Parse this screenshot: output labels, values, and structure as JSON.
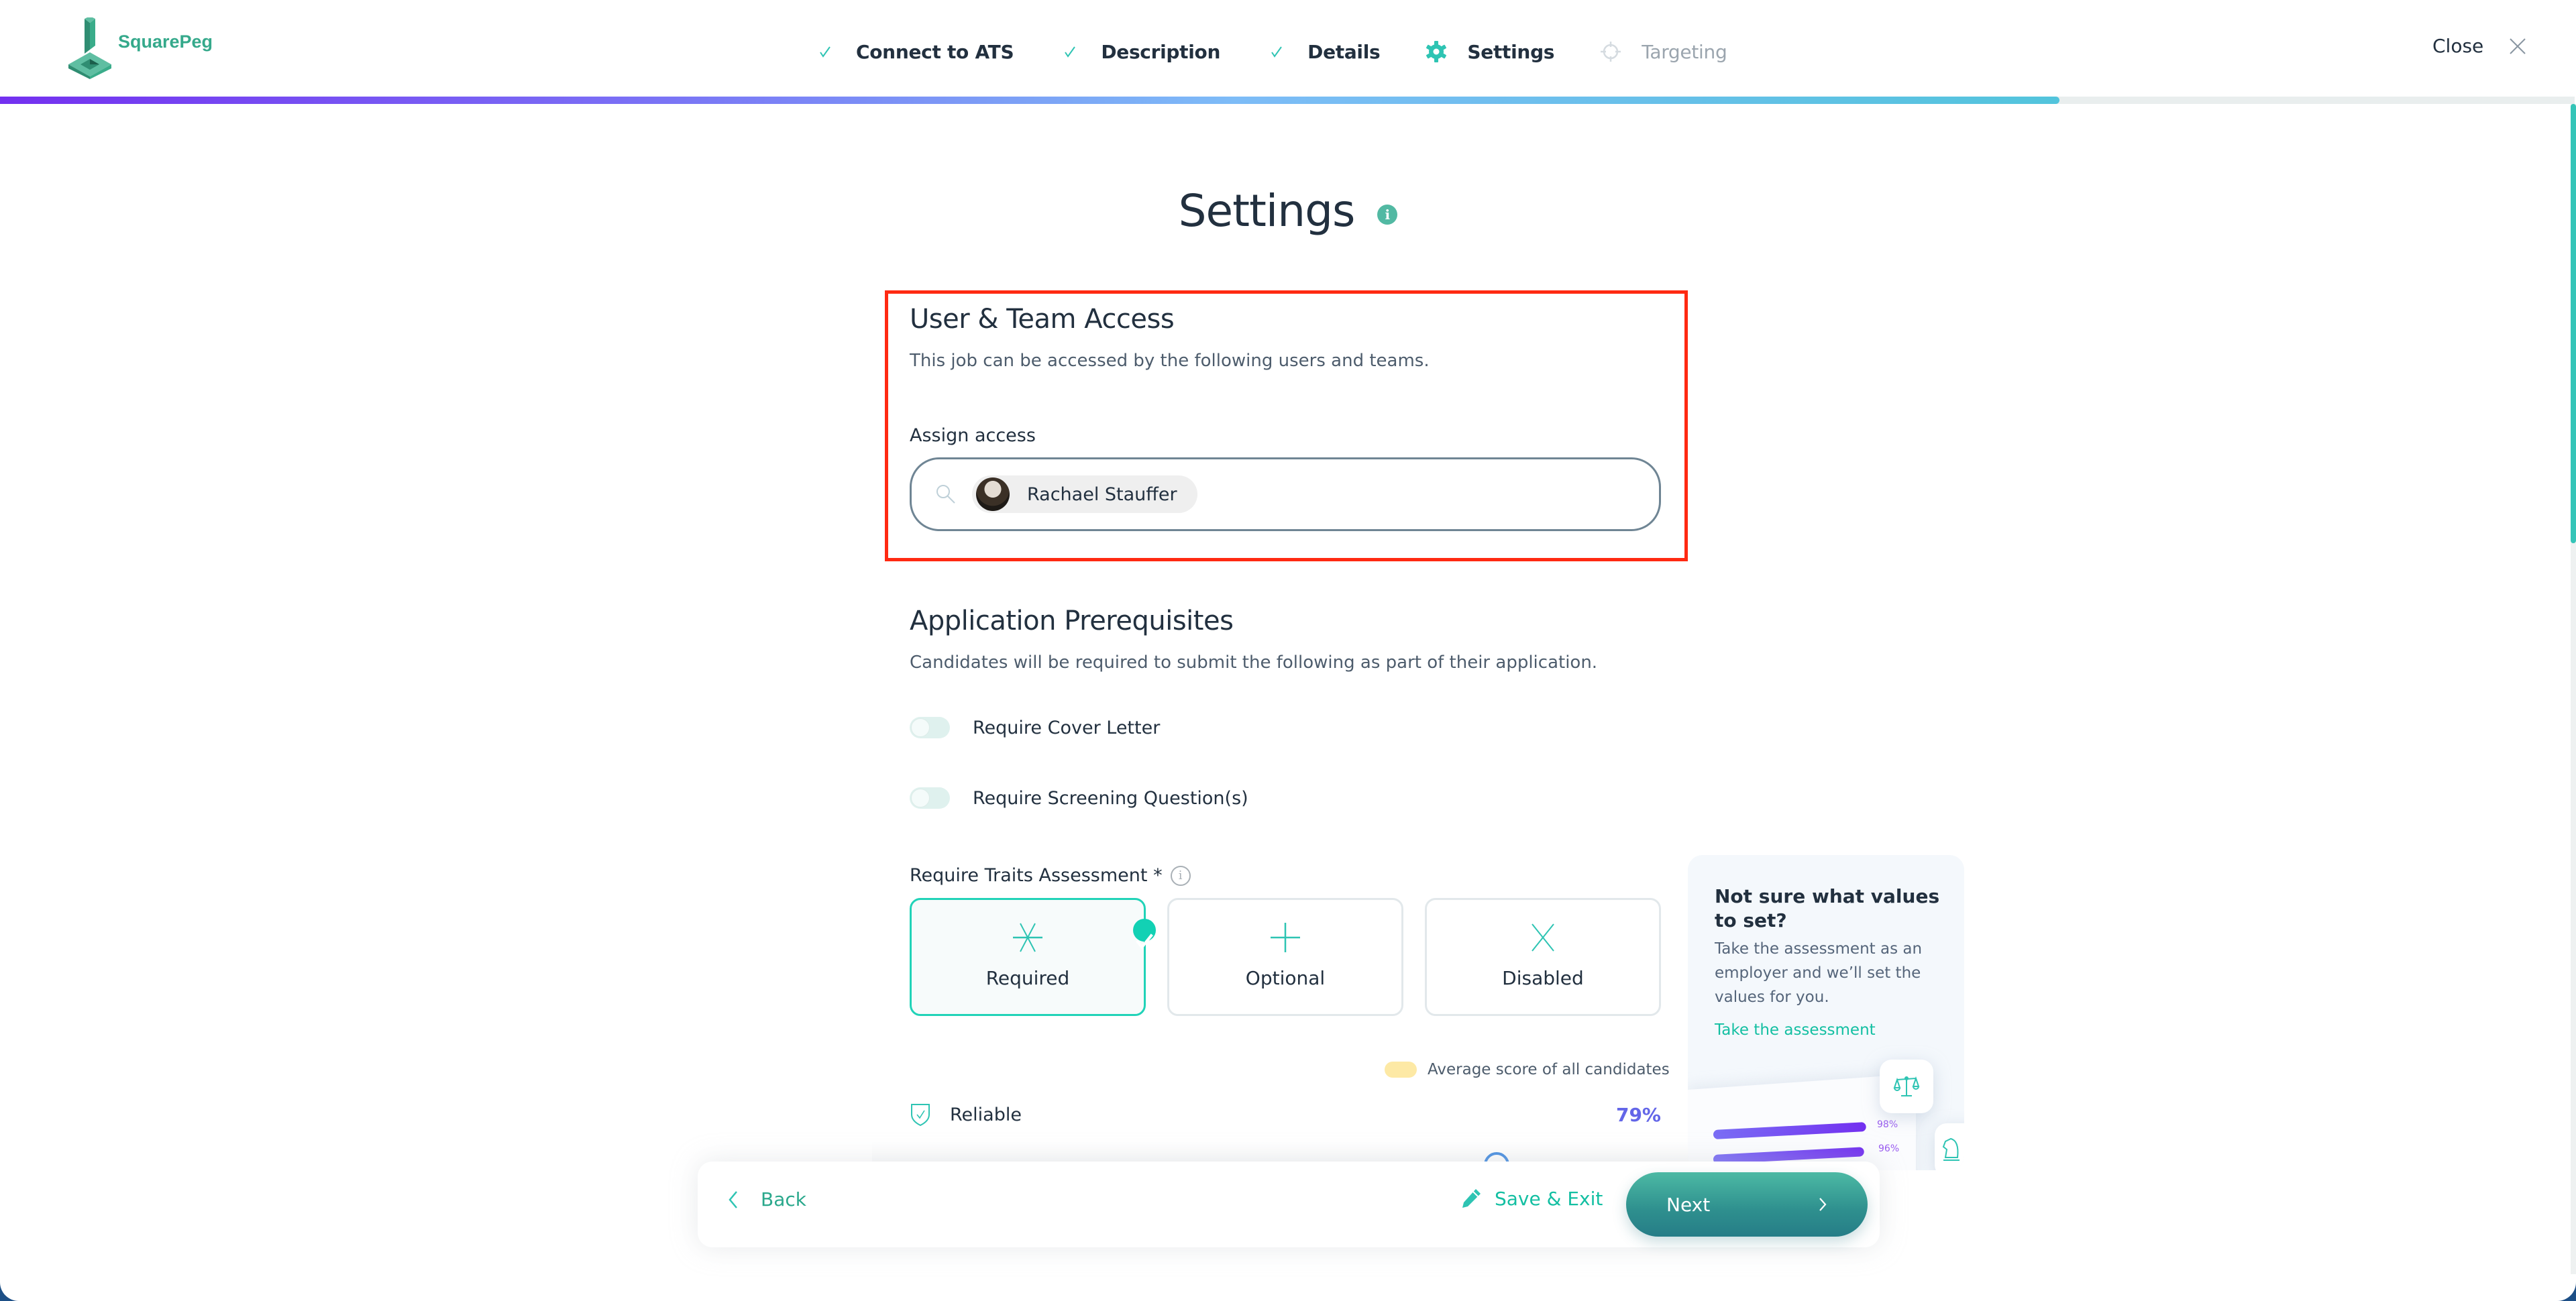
{
  "brand": {
    "name": "SquarePeg",
    "color": "#35a98b"
  },
  "steps": [
    {
      "label": "Connect to ATS",
      "status": "complete",
      "icon": "check-icon"
    },
    {
      "label": "Description",
      "status": "complete",
      "icon": "check-icon"
    },
    {
      "label": "Details",
      "status": "complete",
      "icon": "check-icon"
    },
    {
      "label": "Settings",
      "status": "current",
      "icon": "gear-icon"
    },
    {
      "label": "Targeting",
      "status": "pending",
      "icon": "crosshair-icon"
    }
  ],
  "header": {
    "close_label": "Close"
  },
  "progress": {
    "percent": 80
  },
  "page": {
    "title": "Settings"
  },
  "user_team_access": {
    "title": "User & Team Access",
    "description": "This job can be accessed by the following users and teams.",
    "assign_label": "Assign access",
    "assigned": [
      {
        "name": "Rachael Stauffer"
      }
    ]
  },
  "prerequisites": {
    "title": "Application Prerequisites",
    "description": "Candidates will be required to submit the following as part of their application.",
    "toggles": [
      {
        "label": "Require Cover Letter",
        "on": false
      },
      {
        "label": "Require Screening Question(s)",
        "on": false
      }
    ]
  },
  "traits": {
    "label": "Require Traits Assessment *",
    "options": [
      {
        "label": "Required",
        "selected": true,
        "icon": "asterisk-icon"
      },
      {
        "label": "Optional",
        "selected": false,
        "icon": "plus-icon"
      },
      {
        "label": "Disabled",
        "selected": false,
        "icon": "x-icon"
      }
    ],
    "legend": "Average score of all candidates",
    "rows": [
      {
        "name": "Reliable",
        "value": "79%"
      }
    ]
  },
  "tip": {
    "title": "Not sure what values to set?",
    "body": "Take the assessment as an employer and we’ll set the values for you.",
    "link": "Take the assessment",
    "preview_values": [
      "98%",
      "96%"
    ]
  },
  "footer": {
    "back": "Back",
    "save_exit": "Save & Exit",
    "next": "Next"
  },
  "colors": {
    "accent": "#13bfa2",
    "highlight": "#ff2a12",
    "score": "#6366e8"
  }
}
